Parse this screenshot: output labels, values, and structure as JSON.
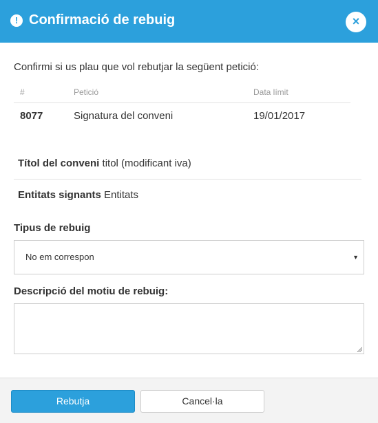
{
  "dialog": {
    "title": "Confirmació de rebuig",
    "warning_icon": "exclamation-circle-icon",
    "close_icon": "close-icon",
    "close_glyph": "×",
    "warn_glyph": "!"
  },
  "intro": "Confirmi si us plau que vol rebutjar la següent petició:",
  "table": {
    "headers": [
      "#",
      "Petició",
      "Data límit"
    ],
    "rows": [
      [
        "8077",
        "Signatura del conveni",
        "19/01/2017"
      ]
    ]
  },
  "details": [
    {
      "label": "Títol del conveni",
      "value": "titol (modificant iva)"
    },
    {
      "label": "Entitats signants",
      "value": "Entitats"
    }
  ],
  "form": {
    "reject_type_label": "Tipus de rebuig",
    "reject_type_value": "No em correspon",
    "description_label": "Descripció del motiu de rebuig:",
    "description_value": ""
  },
  "buttons": {
    "reject": "Rebutja",
    "cancel": "Cancel·la"
  },
  "colors": {
    "accent": "#2ca0dc"
  }
}
